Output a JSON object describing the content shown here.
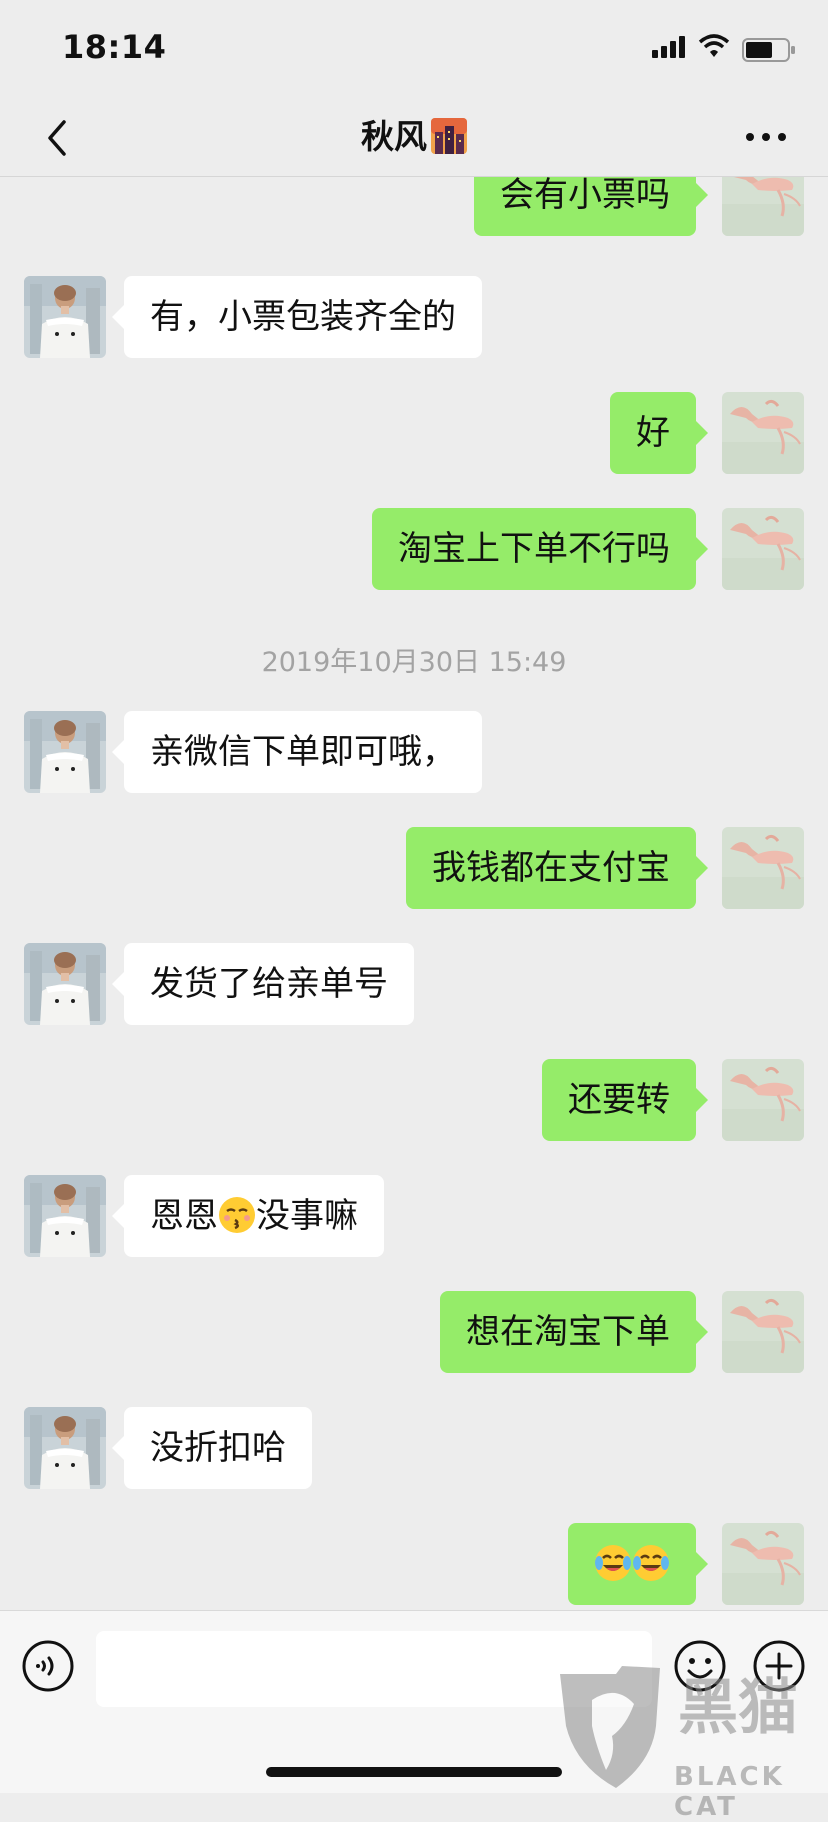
{
  "status_bar": {
    "time": "18:14"
  },
  "header": {
    "title": "秋风"
  },
  "colors": {
    "background": "#ededed",
    "outgoing_bubble": "#95ec69",
    "incoming_bubble": "#ffffff",
    "timestamp_text": "#a3a3a3"
  },
  "messages": [
    {
      "side": "right",
      "text": "会有小票吗"
    },
    {
      "side": "left",
      "text": "有，小票包装齐全的"
    },
    {
      "side": "right",
      "text": "好"
    },
    {
      "side": "right",
      "text": "淘宝上下单不行吗"
    },
    {
      "side": "timestamp",
      "text": "2019年10月30日 15:49"
    },
    {
      "side": "left",
      "text": "亲微信下单即可哦，"
    },
    {
      "side": "right",
      "text": "我钱都在支付宝"
    },
    {
      "side": "left",
      "text": "发货了给亲单号"
    },
    {
      "side": "right",
      "text": "还要转"
    },
    {
      "side": "left",
      "text_before": "恩恩",
      "emoji": "kissing-face-emoji",
      "text_after": "没事嘛"
    },
    {
      "side": "right",
      "text": "想在淘宝下单"
    },
    {
      "side": "left",
      "text": "没折扣哈"
    },
    {
      "side": "right",
      "emoji": "laughing-crying-emoji",
      "emoji_count": 2
    }
  ],
  "input_bar": {
    "placeholder": ""
  },
  "watermark": {
    "text": "BLACK CAT",
    "chinese": "黑猫"
  },
  "icons": [
    "back-icon",
    "more-icon",
    "voice-icon",
    "emoji-icon",
    "plus-icon",
    "signal-icon",
    "wifi-icon",
    "battery-icon"
  ]
}
